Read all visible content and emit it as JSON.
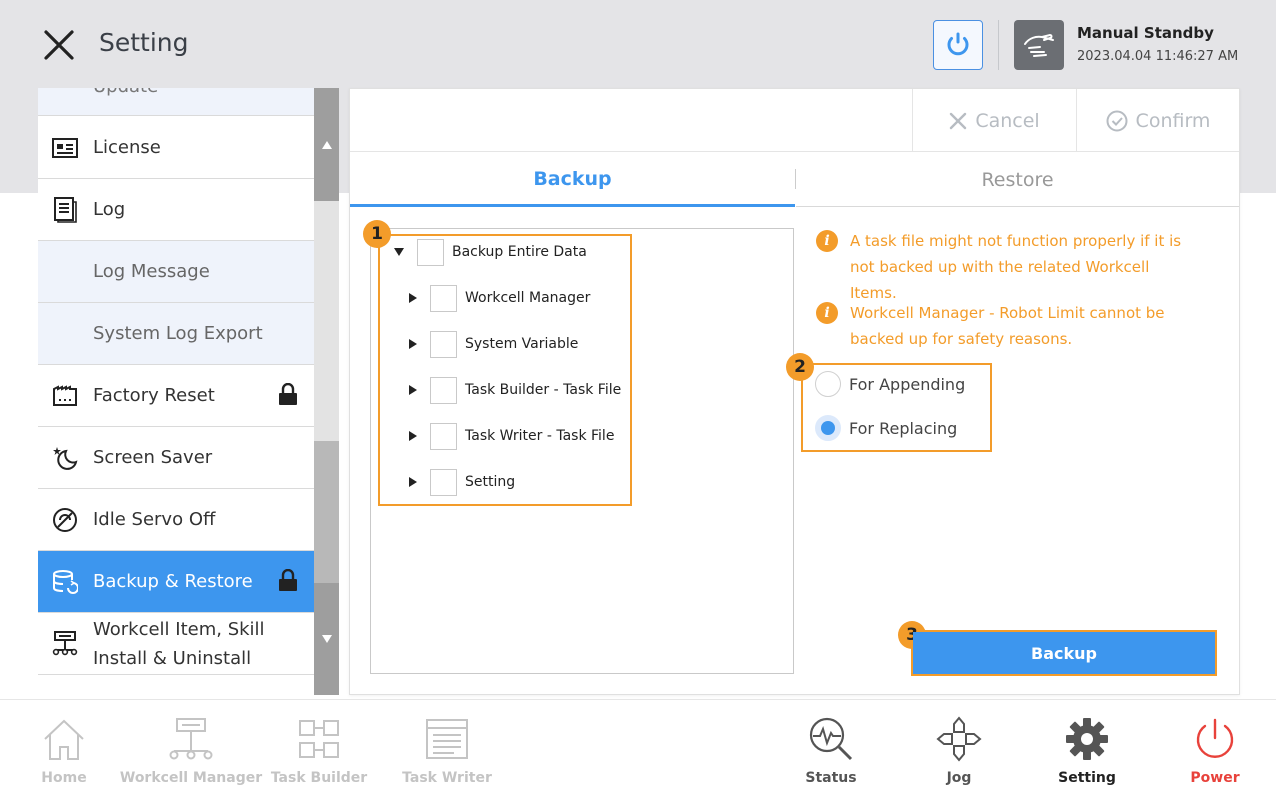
{
  "header": {
    "title": "Setting",
    "mode_label": "Manual Standby",
    "datetime": "2023.04.04 11:46:27 AM"
  },
  "sidebar": {
    "partial_item": "Update",
    "items": [
      {
        "label": "License",
        "icon": "license-icon"
      },
      {
        "label": "Log",
        "icon": "log-icon"
      },
      {
        "label": "Log Message",
        "sub": true
      },
      {
        "label": "System Log Export",
        "sub": true
      },
      {
        "label": "Factory Reset",
        "icon": "factory-icon",
        "locked": true
      },
      {
        "label": "Screen Saver",
        "icon": "moon-icon"
      },
      {
        "label": "Idle Servo Off",
        "icon": "servo-off-icon"
      },
      {
        "label": "Backup & Restore",
        "icon": "database-icon",
        "locked": true,
        "active": true
      },
      {
        "label": "Workcell Item, Skill Install & Uninstall",
        "icon": "workcell-icon"
      }
    ]
  },
  "topbar": {
    "cancel_label": "Cancel",
    "confirm_label": "Confirm"
  },
  "tabs": [
    {
      "label": "Backup",
      "active": true
    },
    {
      "label": "Restore",
      "active": false
    }
  ],
  "tree": {
    "root": "Backup Entire Data",
    "children": [
      "Workcell Manager",
      "System Variable",
      "Task Builder - Task File",
      "Task Writer - Task File",
      "Setting"
    ]
  },
  "warnings": [
    "A task file might not function properly if it is not backed up with the related Workcell Items.",
    "Workcell Manager - Robot Limit cannot be backed up for safety reasons."
  ],
  "options": {
    "items": [
      "For Appending",
      "For Replacing"
    ],
    "selected": "For Replacing"
  },
  "badges": [
    "1",
    "2",
    "3"
  ],
  "backup_button": "Backup",
  "bottom_nav": [
    {
      "label": "Home",
      "icon": "home-icon",
      "enabled": false
    },
    {
      "label": "Workcell Manager",
      "icon": "workcell-manager-icon",
      "enabled": false
    },
    {
      "label": "Task Builder",
      "icon": "task-builder-icon",
      "enabled": false
    },
    {
      "label": "Task Writer",
      "icon": "task-writer-icon",
      "enabled": false
    },
    {
      "label": "Status",
      "icon": "status-icon",
      "enabled": true
    },
    {
      "label": "Jog",
      "icon": "jog-icon",
      "enabled": true
    },
    {
      "label": "Setting",
      "icon": "setting-icon",
      "enabled": true,
      "current": true
    },
    {
      "label": "Power",
      "icon": "power-icon",
      "enabled": true
    }
  ],
  "colors": {
    "accent": "#3d96ee",
    "warning": "#f39c2a",
    "power": "#e8423b"
  }
}
